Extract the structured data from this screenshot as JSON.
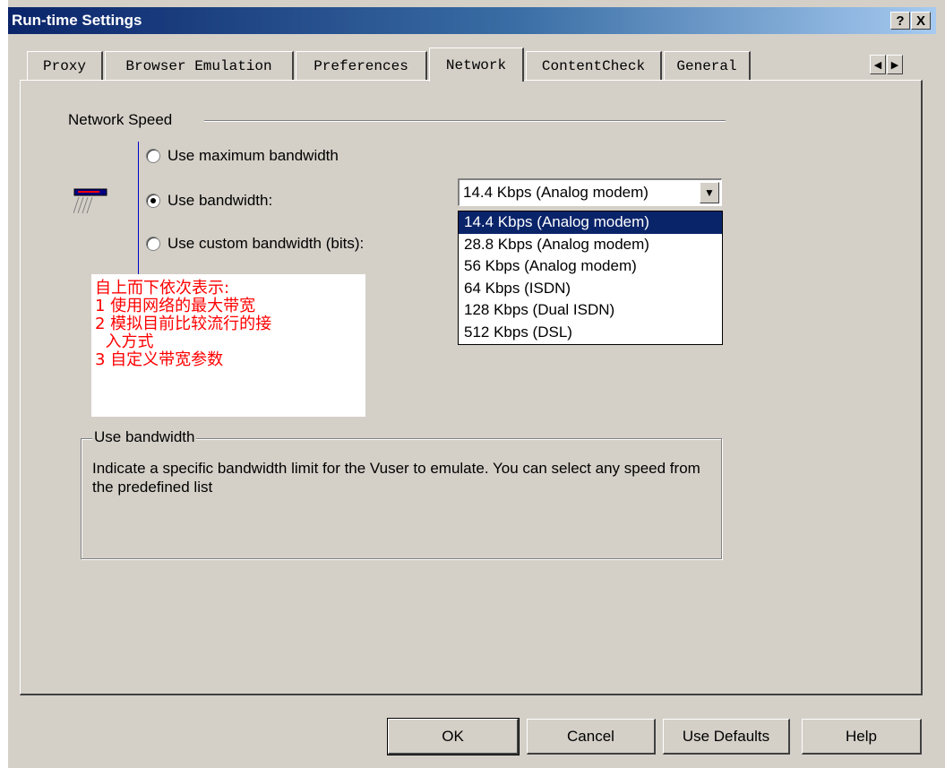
{
  "window": {
    "title": "Run-time Settings",
    "help_button": "?",
    "close_button": "X"
  },
  "tabs": [
    {
      "label": "Proxy"
    },
    {
      "label": "Browser Emulation"
    },
    {
      "label": "Preferences"
    },
    {
      "label": "Network"
    },
    {
      "label": "ContentCheck"
    },
    {
      "label": "General"
    }
  ],
  "tab_scroll": {
    "left": "◀",
    "right": "▶"
  },
  "network_speed": {
    "group_label": "Network Speed",
    "options": [
      {
        "label": "Use maximum bandwidth",
        "checked": false
      },
      {
        "label": "Use bandwidth:",
        "checked": true
      },
      {
        "label": "Use custom bandwidth (bits):",
        "checked": false
      }
    ],
    "combo_value": "14.4 Kbps (Analog modem)",
    "dropdown_options": [
      "14.4 Kbps (Analog modem)",
      "28.8 Kbps (Analog modem)",
      "56 Kbps (Analog modem)",
      "64 Kbps (ISDN)",
      "128 Kbps (Dual ISDN)",
      "512 Kbps (DSL)"
    ],
    "selected_index": 0
  },
  "annotation": {
    "lines": [
      "自上而下依次表示:",
      "1 使用网络的最大带宽",
      "2 模拟目前比较流行的接",
      "  入方式",
      "3 自定义带宽参数"
    ],
    "color": "#ff0000"
  },
  "description": {
    "group_label": "Use bandwidth",
    "text": "Indicate a specific bandwidth limit for the Vuser to emulate. You can select any speed from the predefined list"
  },
  "buttons": {
    "ok": "OK",
    "cancel": "Cancel",
    "use_defaults": "Use Defaults",
    "help": "Help"
  },
  "colors": {
    "titlebar": "#0a246a",
    "dialog": "#d4d0c8",
    "selection": "#0a246a"
  }
}
